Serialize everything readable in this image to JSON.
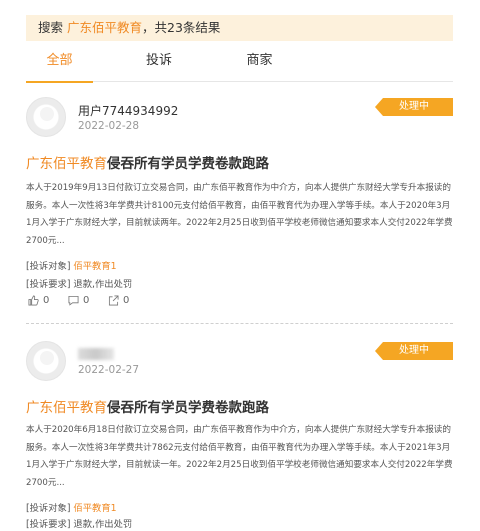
{
  "search": {
    "prefix": "搜索 ",
    "keyword": "广东佰平教育",
    "suffix": "，共23条结果"
  },
  "tabs": [
    {
      "label": "全部",
      "active": true
    },
    {
      "label": "投诉",
      "active": false
    },
    {
      "label": "商家",
      "active": false
    }
  ],
  "colors": {
    "accent": "#f08a24",
    "badge": "#f5a623",
    "banner": "#fdf1dc"
  },
  "posts": [
    {
      "user": "用户7744934992",
      "date": "2022-02-28",
      "status": "处理中",
      "merchant": "广东佰平教育",
      "title_rest": "侵吞所有学员学费卷款跑路",
      "body": "本人于2019年9月13日付款订立交易合同，由广东佰平教育作为中介方，向本人提供广东财经大学专升本报读的服务。本人一次性将3年学费共计8100元支付给佰平教育，由佰平教育代为办理入学等手续。本人于2020年3月1月入学于广东财经大学，目前就读两年。2022年2月25日收到佰平学校老师微信通知要求本人交付2022年学费2700元...",
      "object_label": "[投诉对象]",
      "object_value": "佰平教育1",
      "demand_label": "[投诉要求]",
      "demand_value": "退款,作出处罚",
      "likes": "0",
      "comments": "0",
      "shares": "0"
    },
    {
      "user": "",
      "date": "2022-02-27",
      "status": "处理中",
      "merchant": "广东佰平教育",
      "title_rest": "侵吞所有学员学费卷款跑路",
      "body": "本人于2020年6月18日付款订立交易合同，由广东佰平教育作为中介方，向本人提供广东财经大学专升本报读的服务。本人一次性将3年学费共计7862元支付给佰平教育，由佰平教育代为办理入学等手续。本人于2021年3月1月入学于广东财经大学，目前就读一年。2022年2月25日收到佰平学校老师微信通知要求本人交付2022年学费2700元...",
      "object_label": "[投诉对象]",
      "object_value": "佰平教育1",
      "demand_label": "[投诉要求]",
      "demand_value": "退款,作出处罚"
    }
  ]
}
